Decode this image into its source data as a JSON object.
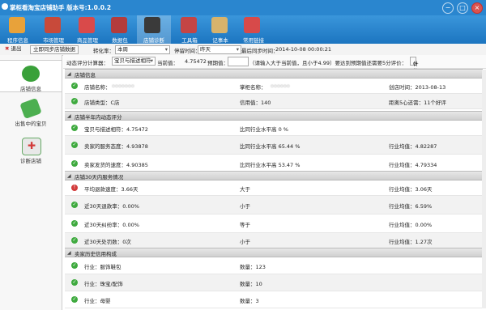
{
  "window": {
    "title": "掌柜看淘宝店铺助手 版本号:1.0.0.2",
    "buttons": [
      "−",
      "□",
      "×"
    ]
  },
  "toolbar": {
    "items": [
      {
        "label": "程序信息",
        "icon": "home-icon",
        "color": "#e8a23a"
      },
      {
        "label": "市场管理",
        "icon": "truck-icon",
        "color": "#c84a3a"
      },
      {
        "label": "商品管理",
        "icon": "cart-icon",
        "color": "#d94a4a"
      },
      {
        "label": "数据包",
        "icon": "gift-icon",
        "color": "#b33c3c"
      },
      {
        "label": "店铺诊断",
        "icon": "monitor-alert-icon",
        "color": "#3a3a3a"
      },
      {
        "label": "工具箱",
        "icon": "toolbox-icon",
        "color": "#c44545"
      },
      {
        "label": "记事本",
        "icon": "notebook-pen-icon",
        "color": "#d7b36c"
      },
      {
        "label": "常用链接",
        "icon": "globe-icon",
        "color": "#d74a4a"
      }
    ]
  },
  "bar2": {
    "exit_label": "退出",
    "sync_button": "立即同步店铺数据",
    "convert_label": "转化率：",
    "convert_value": "本周",
    "stop_label": "停留时间：",
    "stop_value": "昨天",
    "last_sync_label": "最后同步时间：",
    "last_sync_value": "2014-10-08 00:00:21"
  },
  "sidebar": {
    "items": [
      {
        "label": "店铺信息",
        "icon": "magnifier-icon"
      },
      {
        "label": "出售中的宝贝",
        "icon": "tag-icon"
      },
      {
        "label": "诊断店铺",
        "icon": "ambulance-icon"
      }
    ]
  },
  "filter": {
    "dynamic_label": "动态评分计算器：",
    "dynamic_value": "宝贝与描述相符",
    "current_label": "当前值：",
    "current_value": "4.75472",
    "expected_label": "预期值：",
    "expected_hint": "（请输入大于当前值，且小于4.99）要达到预期值还需要5分评价：",
    "calc_button": "计算"
  },
  "sections": [
    {
      "title": "店铺信息",
      "rows": [
        {
          "status": "ok",
          "c1": "店铺名称：",
          "blur1": "ooooooo",
          "c2": "掌柜名称：",
          "blur2": "oooooo",
          "c3": "创店时间：2013-08-13"
        },
        {
          "status": "ok",
          "c1": "店铺类型：C店",
          "c2": "信用值：140",
          "c3": "距离5心还需：11个好评"
        }
      ]
    },
    {
      "title": "店铺半年内动态评分",
      "rows": [
        {
          "status": "ok",
          "c1": "宝贝与描述相符：4.75472",
          "c2": "比同行业水平高 0 %",
          "c3": ""
        },
        {
          "status": "ok",
          "c1": "卖家的服务态度：4.93878",
          "c2": "比同行业水平高 65.44 %",
          "c3": "行业均值：4.82287"
        },
        {
          "status": "ok",
          "c1": "卖家发货的速度：4.90385",
          "c2": "比同行业水平高 53.47 %",
          "c3": "行业均值：4.79334"
        }
      ]
    },
    {
      "title": "店铺30天内服务情况",
      "rows": [
        {
          "status": "bad",
          "c1": "平均退款速度：3.66天",
          "c2": "大于",
          "c3": "行业均值：3.06天"
        },
        {
          "status": "ok",
          "c1": "近30天退款率：0.00%",
          "c2": "小于",
          "c3": "行业均值：6.59%"
        },
        {
          "status": "ok",
          "c1": "近30天纠纷率：0.00%",
          "c2": "等于",
          "c3": "行业均值：0.00%"
        },
        {
          "status": "ok",
          "c1": "近30天处罚数：0次",
          "c2": "小于",
          "c3": "行业均值：1.27次"
        }
      ]
    },
    {
      "title": "卖家历史信用构成",
      "rows": [
        {
          "status": "ok",
          "c1": "行业：服饰鞋包",
          "c2": "数量：123",
          "c3": ""
        },
        {
          "status": "ok",
          "c1": "行业：珠宝/配饰",
          "c2": "数量：10",
          "c3": ""
        },
        {
          "status": "ok",
          "c1": "行业：母婴",
          "c2": "数量：3",
          "c3": ""
        }
      ]
    }
  ],
  "colors": {
    "titlebar": "#2a86cf",
    "ok": "#3faa3f",
    "bad": "#d23a3a"
  }
}
